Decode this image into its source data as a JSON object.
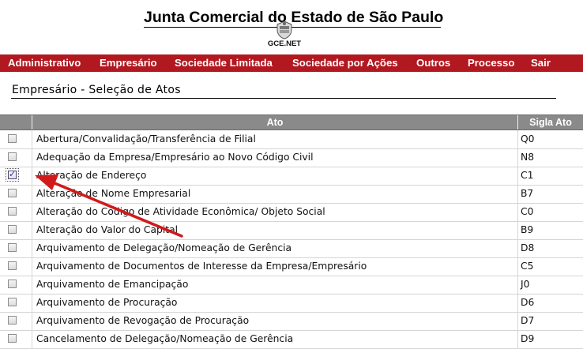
{
  "header": {
    "title": "Junta Comercial do Estado de São Paulo",
    "subtitle": "GCE.NET"
  },
  "menu": {
    "items": [
      {
        "label": "Administrativo"
      },
      {
        "label": "Empresário"
      },
      {
        "label": "Sociedade Limitada"
      },
      {
        "label": "Sociedade por Ações"
      },
      {
        "label": "Outros"
      },
      {
        "label": "Processo"
      },
      {
        "label": "Sair"
      }
    ]
  },
  "page": {
    "title": "Empresário - Seleção de Atos"
  },
  "table": {
    "columns": [
      "",
      "Ato",
      "Sigla Ato"
    ],
    "rows": [
      {
        "ato": "Abertura/Convalidação/Transferência de Filial",
        "sigla": "Q0",
        "checked": false
      },
      {
        "ato": "Adequação da Empresa/Empresário ao Novo Código Civil",
        "sigla": "N8",
        "checked": false
      },
      {
        "ato": "Alteração de Endereço",
        "sigla": "C1",
        "checked": true
      },
      {
        "ato": "Alteração de Nome Empresarial",
        "sigla": "B7",
        "checked": false
      },
      {
        "ato": "Alteração do Código de Atividade Econômica/ Objeto Social",
        "sigla": "C0",
        "checked": false
      },
      {
        "ato": "Alteração do Valor do Capital",
        "sigla": "B9",
        "checked": false
      },
      {
        "ato": "Arquivamento de Delegação/Nomeação de Gerência",
        "sigla": "D8",
        "checked": false
      },
      {
        "ato": "Arquivamento de Documentos de Interesse da Empresa/Empresário",
        "sigla": "C5",
        "checked": false
      },
      {
        "ato": "Arquivamento de Emancipação",
        "sigla": "J0",
        "checked": false
      },
      {
        "ato": "Arquivamento de Procuração",
        "sigla": "D6",
        "checked": false
      },
      {
        "ato": "Arquivamento de Revogação de Procuração",
        "sigla": "D7",
        "checked": false
      },
      {
        "ato": "Cancelamento de Delegação/Nomeação de Gerência",
        "sigla": "D9",
        "checked": false
      }
    ]
  },
  "colors": {
    "menu_bg": "#b11820",
    "header_bg": "#8a8a8a",
    "arrow": "#d11a1a"
  },
  "icons": {
    "seal": "coat-of-arms-icon",
    "checkbox": "checkbox-icon",
    "annotation": "red-arrow-annotation"
  }
}
